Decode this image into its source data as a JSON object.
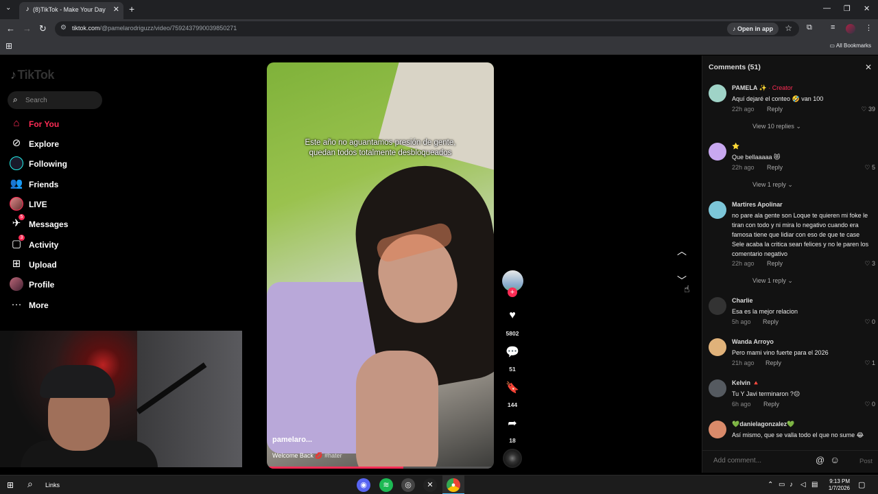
{
  "browser": {
    "tab_title": "(8)TikTok - Make Your Day",
    "url_host": "tiktok.com",
    "url_path": "/@pamelarodriguzz/video/7592437990039850271",
    "open_in_app": "Open in app",
    "all_bookmarks": "All Bookmarks"
  },
  "sidebar": {
    "logo": "TikTok",
    "search_placeholder": "Search",
    "items": [
      {
        "label": "For You",
        "icon": "home-icon",
        "active": true
      },
      {
        "label": "Explore",
        "icon": "compass-icon"
      },
      {
        "label": "Following",
        "icon": "following-avatar"
      },
      {
        "label": "Friends",
        "icon": "friends-icon"
      },
      {
        "label": "LIVE",
        "icon": "live-avatar"
      },
      {
        "label": "Messages",
        "icon": "messages-icon",
        "badge": "5"
      },
      {
        "label": "Activity",
        "icon": "activity-icon",
        "badge": "3"
      },
      {
        "label": "Upload",
        "icon": "upload-icon"
      },
      {
        "label": "Profile",
        "icon": "profile-avatar"
      },
      {
        "label": "More",
        "icon": "more-icon"
      }
    ]
  },
  "video": {
    "caption_line1": "Este año no aguantamos presión de gente,",
    "caption_line2": "quedan todos totalmente desbloqueados",
    "username": "pamelaro...",
    "description": "Welcome Back 💋",
    "hashtag": "#hater",
    "progress": 0.6
  },
  "actions": {
    "likes": "5802",
    "comments": "51",
    "saves": "144",
    "shares": "18"
  },
  "comments_panel": {
    "title": "Comments (51)",
    "add_placeholder": "Add comment...",
    "post_label": "Post",
    "items": [
      {
        "name": "PAMELA ✨",
        "creator": "· Creator",
        "text": "Aquí dejaré el conteo 🤣 van 100",
        "time": "22h ago",
        "reply": "Reply",
        "likes": "39",
        "more": "View 10 replies ⌄",
        "avatar_color": "#9fd3c7"
      },
      {
        "name": "⭐",
        "creator": "",
        "text": "Que bellaaaaa 😻",
        "time": "22h ago",
        "reply": "Reply",
        "likes": "5",
        "more": "View 1 reply ⌄",
        "avatar_color": "#c8a8f0"
      },
      {
        "name": "Martires Apolinar",
        "creator": "",
        "text": "no pare ala gente son Loque te quieren mi foke le tiran con todo y ni mira lo negativo cuando era famosa tiene que lidiar con eso de que te case Sele acaba la critica sean felices y no le paren los comentario negativo",
        "time": "22h ago",
        "reply": "Reply",
        "likes": "3",
        "more": "View 1 reply ⌄",
        "avatar_color": "#7cc6d8"
      },
      {
        "name": "Charlie",
        "creator": "",
        "text": "Esa es la mejor relacion",
        "time": "5h ago",
        "reply": "Reply",
        "likes": "0",
        "more": "",
        "avatar_color": "#333333"
      },
      {
        "name": "Wanda Arroyo",
        "creator": "",
        "text": "Pero mami vino fuerte para el 2026",
        "time": "21h ago",
        "reply": "Reply",
        "likes": "1",
        "more": "",
        "avatar_color": "#e0b27a"
      },
      {
        "name": "Kelvin 🔺",
        "creator": "",
        "text": "Tu Y Javi terminaron ?😔",
        "time": "6h ago",
        "reply": "Reply",
        "likes": "0",
        "more": "",
        "avatar_color": "#555a60"
      },
      {
        "name": "💚danielagonzalez💚",
        "creator": "",
        "text": "Así mismo, que se valla todo el que no sume 😂",
        "time": "",
        "reply": "",
        "likes": "",
        "more": "",
        "avatar_color": "#d98a6a"
      }
    ]
  },
  "taskbar": {
    "links": "Links",
    "time": "9:13 PM",
    "date": "1/7/2026"
  }
}
